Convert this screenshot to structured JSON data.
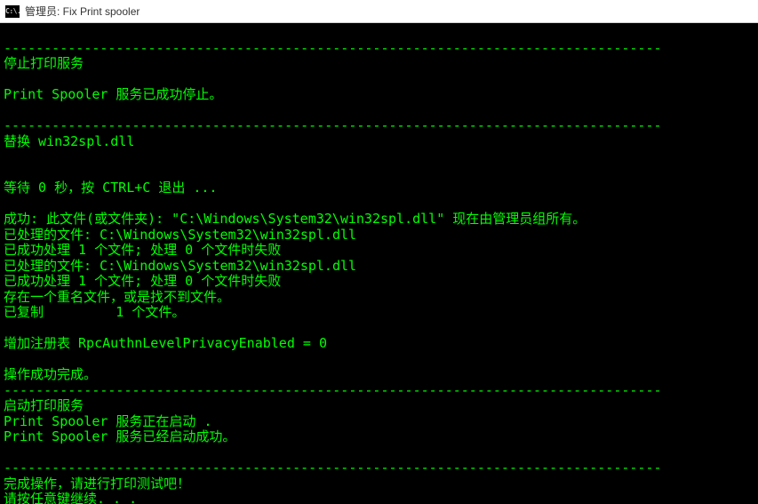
{
  "window": {
    "icon_text": "C:\\.",
    "title": "管理员:  Fix Print spooler"
  },
  "terminal": {
    "lines": [
      "",
      "----------------------------------------------------------------------------------",
      "停止打印服务",
      "",
      "Print Spooler 服务已成功停止。",
      "",
      "----------------------------------------------------------------------------------",
      "替换 win32spl.dll",
      "",
      "",
      "等待 0 秒，按 CTRL+C 退出 ...",
      "",
      "成功: 此文件(或文件夹): \"C:\\Windows\\System32\\win32spl.dll\" 现在由管理员组所有。",
      "已处理的文件: C:\\Windows\\System32\\win32spl.dll",
      "已成功处理 1 个文件; 处理 0 个文件时失败",
      "已处理的文件: C:\\Windows\\System32\\win32spl.dll",
      "已成功处理 1 个文件; 处理 0 个文件时失败",
      "存在一个重名文件，或是找不到文件。",
      "已复制         1 个文件。",
      "",
      "增加注册表 RpcAuthnLevelPrivacyEnabled = 0",
      "",
      "操作成功完成。",
      "----------------------------------------------------------------------------------",
      "启动打印服务",
      "Print Spooler 服务正在启动 .",
      "Print Spooler 服务已经启动成功。",
      "",
      "----------------------------------------------------------------------------------",
      "完成操作，请进行打印测试吧！",
      "请按任意键继续. . ."
    ]
  }
}
